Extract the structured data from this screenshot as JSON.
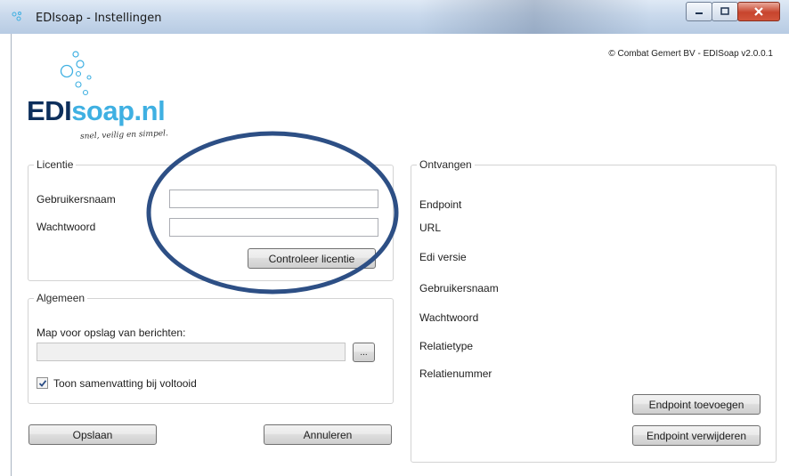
{
  "window": {
    "title": "EDIsoap - Instellingen"
  },
  "header": {
    "copyright": "© Combat Gemert BV - EDISoap v2.0.0.1"
  },
  "logo": {
    "part1": "EDI",
    "part2": "soap.nl",
    "tagline": "snel, veilig en simpel."
  },
  "licentie": {
    "title": "Licentie",
    "username_label": "Gebruikersnaam",
    "username_value": "",
    "password_label": "Wachtwoord",
    "password_value": "",
    "check_button": "Controleer licentie"
  },
  "algemeen": {
    "title": "Algemeen",
    "folder_label": "Map voor opslag van berichten:",
    "folder_value": "",
    "browse_button": "...",
    "summary_checkbox_label": "Toon samenvatting bij voltooid",
    "summary_checked": true
  },
  "buttons": {
    "save": "Opslaan",
    "cancel": "Annuleren"
  },
  "ontvangen": {
    "title": "Ontvangen",
    "fields": [
      "Endpoint",
      "URL",
      "Edi versie",
      "Gebruikersnaam",
      "Wachtwoord",
      "Relatietype",
      "Relatienummer"
    ],
    "add_button": "Endpoint toevoegen",
    "remove_button": "Endpoint verwijderen"
  },
  "colors": {
    "annotation_oval": "#2d4f85",
    "logo_dark": "#0d2f5c",
    "logo_light": "#3fb0e2"
  }
}
